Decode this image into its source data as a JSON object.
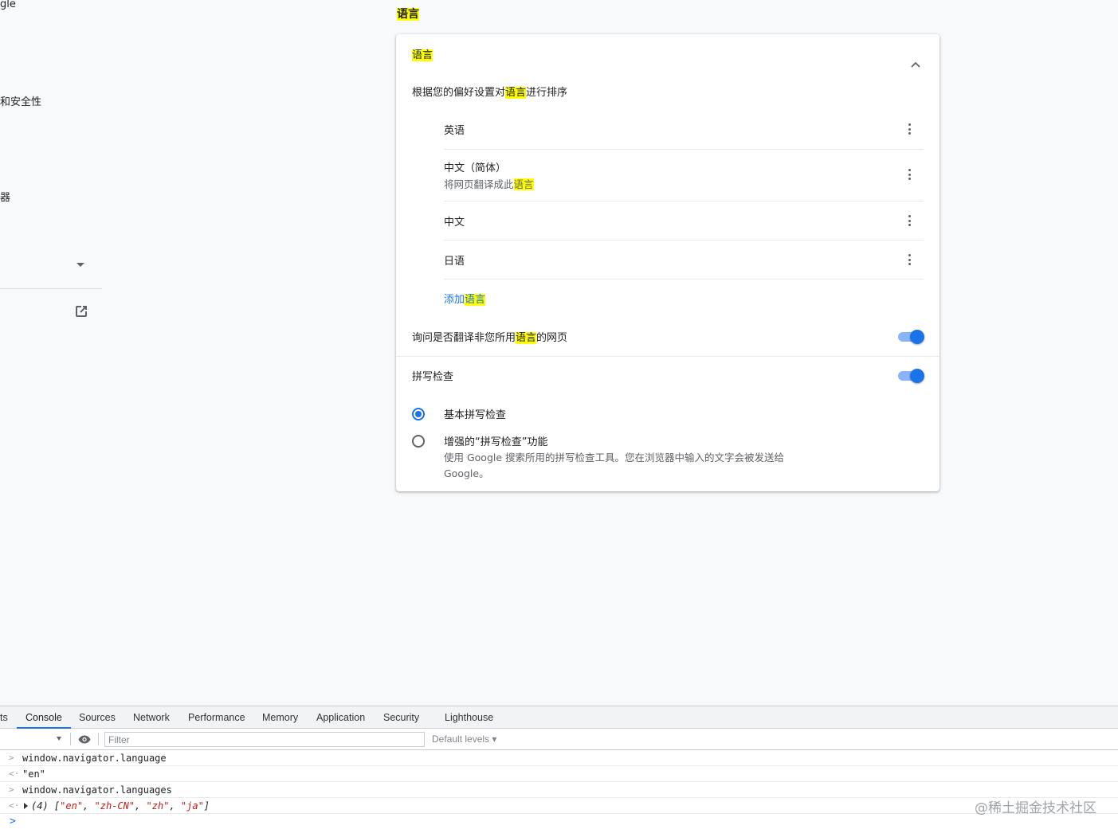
{
  "sidebar": {
    "frag_google": "gle",
    "frag_security": "和安全性",
    "frag_browser": "器"
  },
  "section": {
    "heading": "语言"
  },
  "card": {
    "title": "语言",
    "order_pre": "根据您的偏好设置对",
    "order_hl": "语言",
    "order_post": "进行排序",
    "languages": [
      {
        "name": "英语",
        "sub": "",
        "sub_hl": ""
      },
      {
        "name": "中文（简体）",
        "sub": "将网页翻译成此",
        "sub_hl": "语言"
      },
      {
        "name": "中文",
        "sub": "",
        "sub_hl": ""
      },
      {
        "name": "日语",
        "sub": "",
        "sub_hl": ""
      }
    ],
    "add_pre": "添加",
    "add_hl": "语言",
    "translate_pre": "询问是否翻译非您所用",
    "translate_hl": "语言",
    "translate_post": "的网页",
    "translate_toggle": "on",
    "spell_label": "拼写检查",
    "spell_toggle": "on",
    "basic_label": "基本拼写检查",
    "basic_selected": true,
    "enhanced_label": "增强的“拼写检查”功能",
    "enhanced_desc1": "使用 Google 搜索所用的拼写检查工具。您在浏览器中输入的文字会被发送给",
    "enhanced_desc2": "Google。"
  },
  "devtools": {
    "tabs": [
      "ts",
      "Console",
      "Sources",
      "Network",
      "Performance",
      "Memory",
      "Application",
      "Security",
      "Lighthouse"
    ],
    "active_tab": "Console",
    "filter_placeholder": "Filter",
    "levels": "Default levels ▾",
    "console": [
      {
        "kind": "input",
        "gutter": ">",
        "text": "window.navigator.language"
      },
      {
        "kind": "output",
        "gutter": "<·",
        "text": "\"en\""
      },
      {
        "kind": "input",
        "gutter": ">",
        "text": "window.navigator.languages"
      },
      {
        "kind": "output",
        "gutter": "<·",
        "count": "(4)",
        "items": [
          "\"en\"",
          "\"zh-CN\"",
          "\"zh\"",
          "\"ja\""
        ]
      }
    ],
    "prompt": ">"
  },
  "watermark": "@稀土掘金技术社区",
  "colors": {
    "accent": "#1a73e8",
    "highlight": "#ffff00",
    "toggle_track": "#8ab4f8"
  }
}
